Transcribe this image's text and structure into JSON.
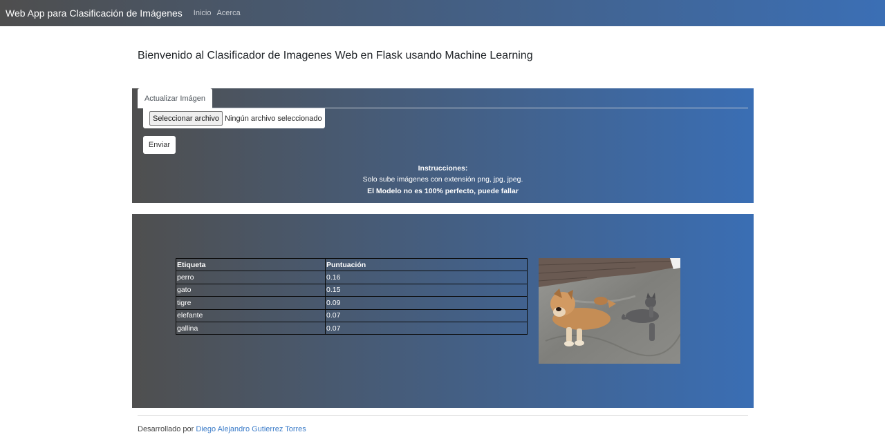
{
  "navbar": {
    "brand": "Web App para Clasificación de Imágenes",
    "links": [
      "Inicio",
      "Acerca"
    ],
    "gradient_start": "#4e4e4e",
    "gradient_end": "#3b6fb5"
  },
  "welcome": "Bienvenido al Clasificador de Imagenes Web en Flask usando Machine Learning",
  "upload": {
    "tab_label": "Actualizar Imágen",
    "file_button": "Seleccionar archivo",
    "file_status": "Ningún archivo seleccionado",
    "submit": "Enviar",
    "instructions_title": "Instrucciones:",
    "instructions_text": "Solo sube imágenes con extensión png, jpg, jpeg.",
    "instructions_warning": "El Modelo no es 100% perfecto, puede fallar"
  },
  "results": {
    "headers": [
      "Etiqueta",
      "Puntuación"
    ],
    "rows": [
      [
        "perro",
        "0.16"
      ],
      [
        "gato",
        "0.15"
      ],
      [
        "tigre",
        "0.09"
      ],
      [
        "elefante",
        "0.07"
      ],
      [
        "gallina",
        "0.07"
      ]
    ],
    "image_icon": "uploaded-photo-dog-and-cat"
  },
  "footer": {
    "prefix": "Desarrollado por",
    "author": "Diego Alejandro Gutierrez Torres",
    "link_color": "#3a7bc8"
  }
}
